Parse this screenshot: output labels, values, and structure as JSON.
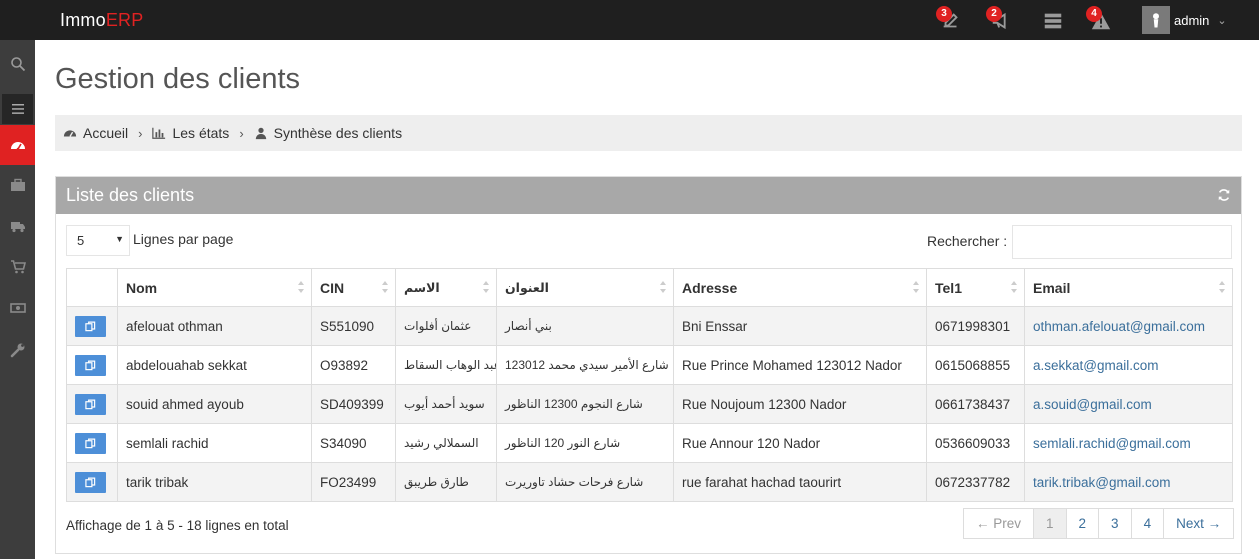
{
  "brand": {
    "prefix": "Immo",
    "accent": "ERP"
  },
  "colors": {
    "accent": "#e02222",
    "topbar": "#1f1f1f",
    "sidebar": "#3d3d3d",
    "portlet_head": "#a8a8a8",
    "action_button": "#4d8fd8",
    "link": "#3b6f9b"
  },
  "topbar": {
    "notifications": [
      {
        "icon": "edit-icon",
        "count": "3"
      },
      {
        "icon": "megaphone-icon",
        "count": "2"
      },
      {
        "icon": "server-icon",
        "count": ""
      },
      {
        "icon": "warning-icon",
        "count": "4"
      }
    ],
    "user": {
      "name": "admin"
    }
  },
  "sidebar": {
    "items": [
      "search-icon",
      "menu-icon",
      "dashboard-icon",
      "briefcase-icon",
      "truck-icon",
      "cart-icon",
      "money-icon",
      "wrench-icon"
    ],
    "active": "dashboard-icon"
  },
  "page": {
    "title": "Gestion des clients"
  },
  "breadcrumb": [
    {
      "label": "Accueil",
      "icon": "dashboard-icon"
    },
    {
      "label": "Les états",
      "icon": "bar-chart-icon"
    },
    {
      "label": "Synthèse des clients",
      "icon": "user-icon"
    }
  ],
  "portlet": {
    "title": "Liste des clients"
  },
  "controls": {
    "page_length": "5",
    "page_length_label": "Lignes par page",
    "search_label": "Rechercher :",
    "search_value": ""
  },
  "table": {
    "headers": {
      "nom": "Nom",
      "cin": "CIN",
      "ism": "الاسم",
      "unwan": "العنوان",
      "adresse": "Adresse",
      "tel": "Tel1",
      "email": "Email"
    },
    "rows": [
      {
        "nom": "afelouat othman",
        "cin": "S551090",
        "ism": "عثمان أفلوات",
        "unwan": "بني أنصار",
        "adresse": "Bni Enssar",
        "tel": "0671998301",
        "email": "othman.afelouat@gmail.com"
      },
      {
        "nom": "abdelouahab sekkat",
        "cin": "O93892",
        "ism": "عبد الوهاب السقاط",
        "unwan": "شارع الأمير سيدي محمد 123012",
        "adresse": "Rue Prince Mohamed 123012 Nador",
        "tel": "0615068855",
        "email": "a.sekkat@gmail.com"
      },
      {
        "nom": "souid ahmed ayoub",
        "cin": "SD409399",
        "ism": "سويد أحمد أيوب",
        "unwan": "شارع النجوم 12300 الناظور",
        "adresse": "Rue Noujoum 12300 Nador",
        "tel": "0661738437",
        "email": "a.souid@gmail.com"
      },
      {
        "nom": "semlali rachid",
        "cin": "S34090",
        "ism": "السملالي رشيد",
        "unwan": "شارع النور 120 الناظور",
        "adresse": "Rue Annour 120 Nador",
        "tel": "0536609033",
        "email": "semlali.rachid@gmail.com"
      },
      {
        "nom": "tarik tribak",
        "cin": "FO23499",
        "ism": "طارق طريبق",
        "unwan": "شارع فرحات حشاد تاوريرت",
        "adresse": "rue farahat hachad taourirt",
        "tel": "0672337782",
        "email": "tarik.tribak@gmail.com"
      }
    ]
  },
  "footer": {
    "info": "Affichage de 1 à 5 - 18 lignes en total",
    "pagination": {
      "prev": "← Prev",
      "pages": [
        "1",
        "2",
        "3",
        "4"
      ],
      "current": "1",
      "next": "Next →"
    }
  }
}
